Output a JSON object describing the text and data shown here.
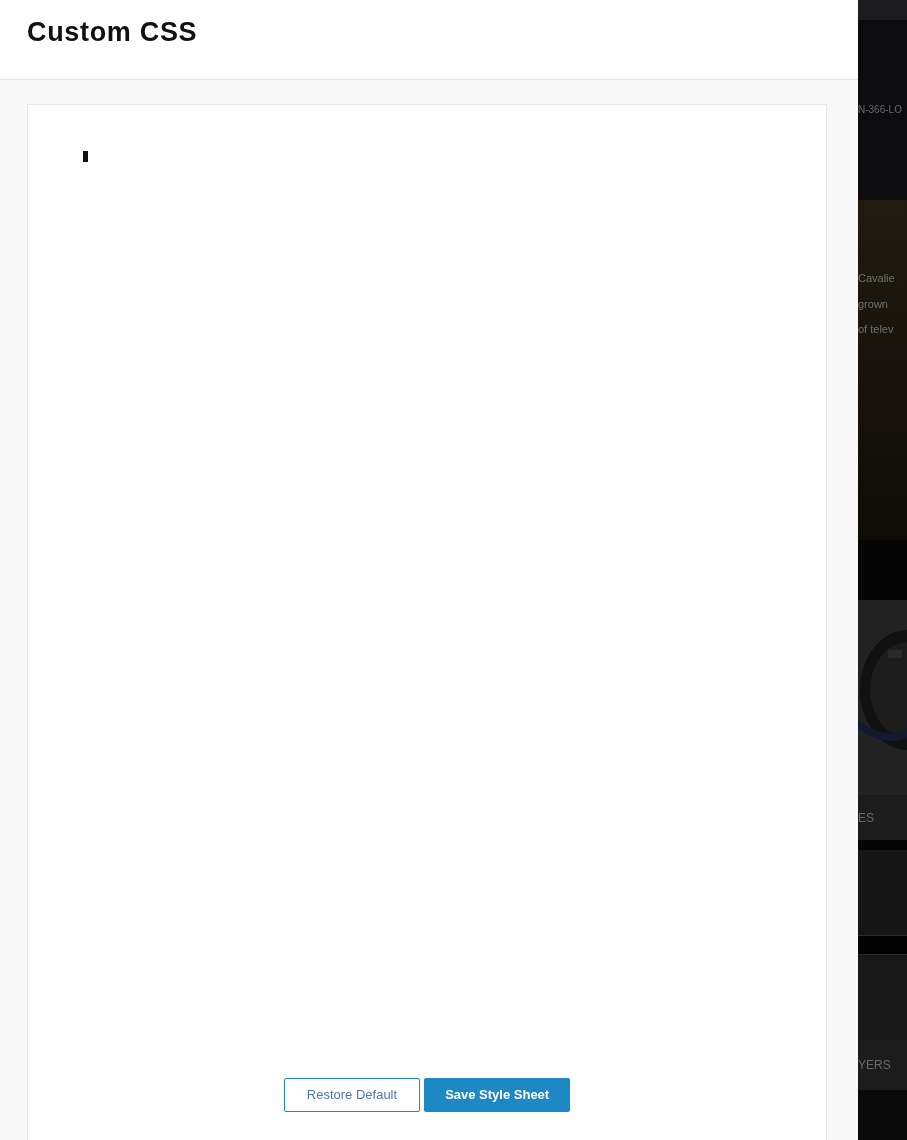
{
  "panel": {
    "title": "Custom CSS",
    "buttons": [
      {
        "label": "Restore Default",
        "kind": "secondary"
      },
      {
        "label": "Save Style Sheet",
        "kind": "primary"
      }
    ]
  },
  "background_page": {
    "code": "N-366-LO",
    "lines": [
      "Cavalie",
      "grown",
      "of telev"
    ],
    "tab_1": "ES",
    "tab_2": "YERS"
  }
}
